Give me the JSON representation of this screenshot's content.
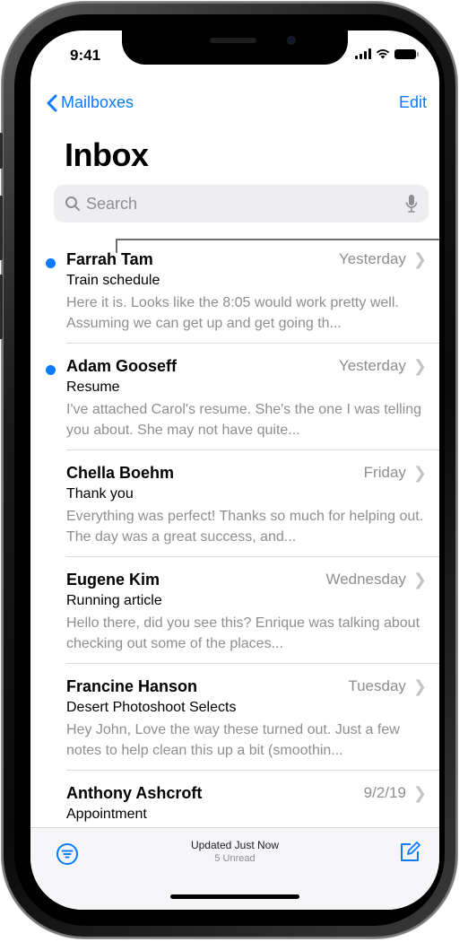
{
  "status_bar": {
    "time": "9:41"
  },
  "nav": {
    "back_label": "Mailboxes",
    "edit_label": "Edit"
  },
  "title": "Inbox",
  "search": {
    "placeholder": "Search"
  },
  "emails": [
    {
      "sender": "Farrah Tam",
      "date": "Yesterday",
      "subject": "Train schedule",
      "preview": "Here it is. Looks like the 8:05 would work pretty well. Assuming we can get up and get going th...",
      "unread": true
    },
    {
      "sender": "Adam Gooseff",
      "date": "Yesterday",
      "subject": "Resume",
      "preview": "I've attached Carol's resume. She's the one I was telling you about. She may not have quite...",
      "unread": true
    },
    {
      "sender": "Chella Boehm",
      "date": "Friday",
      "subject": "Thank you",
      "preview": "Everything was perfect! Thanks so much for helping out. The day was a great success, and...",
      "unread": false
    },
    {
      "sender": "Eugene Kim",
      "date": "Wednesday",
      "subject": "Running article",
      "preview": "Hello there, did you see this? Enrique was talking about checking out some of the places...",
      "unread": false
    },
    {
      "sender": "Francine Hanson",
      "date": "Tuesday",
      "subject": "Desert Photoshoot Selects",
      "preview": "Hey John, Love the way these turned out. Just a few notes to help clean this up a bit (smoothin...",
      "unread": false
    },
    {
      "sender": "Anthony Ashcroft",
      "date": "9/2/19",
      "subject": "Appointment",
      "preview": "",
      "unread": false
    }
  ],
  "toolbar": {
    "status_main": "Updated Just Now",
    "status_sub": "5 Unread"
  },
  "colors": {
    "accent": "#0a7aff",
    "secondary_text": "#8e8e93"
  },
  "icons": [
    "chevron-left-icon",
    "search-icon",
    "microphone-icon",
    "chevron-right-icon",
    "filter-icon",
    "compose-icon"
  ]
}
